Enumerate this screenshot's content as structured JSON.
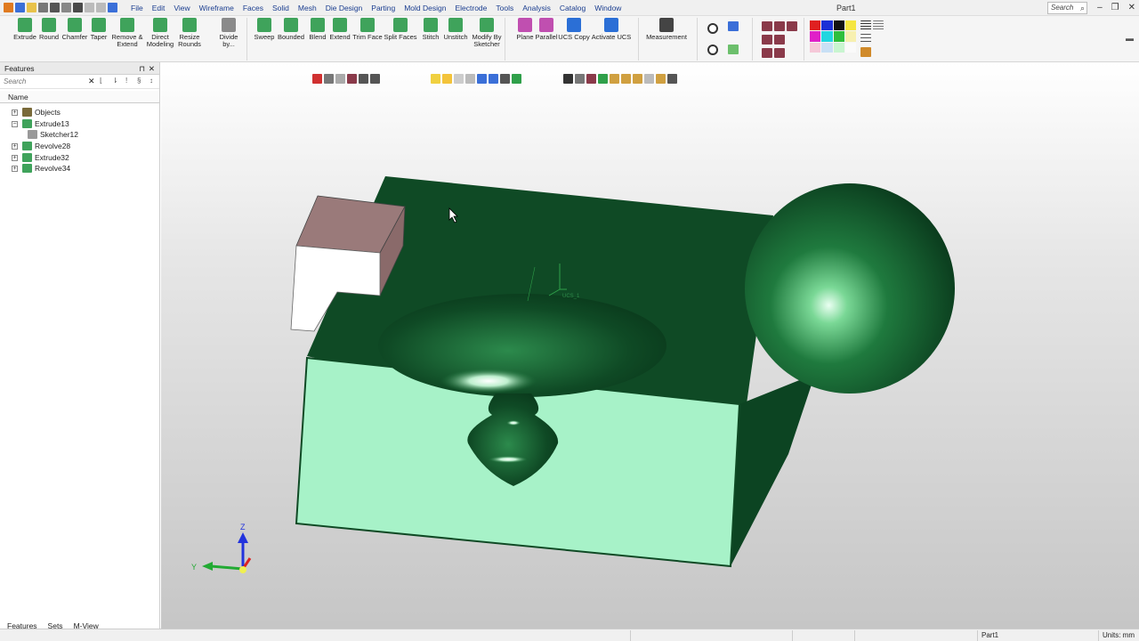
{
  "app": {
    "document_title": "Part1",
    "search_placeholder": "Search"
  },
  "menu": [
    "File",
    "Edit",
    "View",
    "Wireframe",
    "Faces",
    "Solid",
    "Mesh",
    "Die Design",
    "Parting",
    "Mold Design",
    "Electrode",
    "Tools",
    "Analysis",
    "Catalog",
    "Window"
  ],
  "ribbon": {
    "buttons": [
      {
        "label": "Extrude",
        "icon": "extrude-icon",
        "color": "#3fa35b"
      },
      {
        "label": "Round",
        "icon": "round-icon",
        "color": "#3fa35b"
      },
      {
        "label": "Chamfer",
        "icon": "chamfer-icon",
        "color": "#3fa35b"
      },
      {
        "label": "Taper",
        "icon": "taper-icon",
        "color": "#3fa35b"
      },
      {
        "label": "Remove &\nExtend",
        "icon": "remove-extend-icon",
        "color": "#3fa35b"
      },
      {
        "label": "Direct\nModeling",
        "icon": "direct-modeling-icon",
        "color": "#3fa35b"
      },
      {
        "label": "Resize\nRounds",
        "icon": "resize-rounds-icon",
        "color": "#3fa35b"
      },
      {
        "label": "Divide\nby...",
        "icon": "divide-icon",
        "color": "#8a8a8a"
      },
      {
        "label": "Sweep",
        "icon": "sweep-icon",
        "color": "#3fa35b"
      },
      {
        "label": "Bounded",
        "icon": "bounded-icon",
        "color": "#3fa35b"
      },
      {
        "label": "Blend",
        "icon": "blend-icon",
        "color": "#3fa35b"
      },
      {
        "label": "Extend",
        "icon": "extend-icon",
        "color": "#3fa35b"
      },
      {
        "label": "Trim Face",
        "icon": "trim-face-icon",
        "color": "#3fa35b"
      },
      {
        "label": "Split Faces",
        "icon": "split-faces-icon",
        "color": "#3fa35b"
      },
      {
        "label": "Stitch",
        "icon": "stitch-icon",
        "color": "#3fa35b"
      },
      {
        "label": "Unstitch",
        "icon": "unstitch-icon",
        "color": "#3fa35b"
      },
      {
        "label": "Modify By\nSketcher",
        "icon": "modify-sketcher-icon",
        "color": "#3fa35b"
      },
      {
        "label": "Plane",
        "icon": "plane-icon",
        "color": "#c04fb0"
      },
      {
        "label": "Parallel",
        "icon": "parallel-icon",
        "color": "#c04fb0"
      },
      {
        "label": "UCS Copy",
        "icon": "ucs-copy-icon",
        "color": "#2b6fd6"
      },
      {
        "label": "Activate UCS",
        "icon": "activate-ucs-icon",
        "color": "#2b6fd6"
      },
      {
        "label": "Measurement",
        "icon": "measurement-icon",
        "color": "#444444"
      }
    ]
  },
  "panel": {
    "title": "Features",
    "search_placeholder": "Search",
    "column_header": "Name",
    "tree": [
      {
        "label": "Objects",
        "expander": "+"
      },
      {
        "label": "Extrude13",
        "expander": "−"
      },
      {
        "label": "Sketcher12",
        "expander": ""
      },
      {
        "label": "Revolve28",
        "expander": "+"
      },
      {
        "label": "Extrude32",
        "expander": "+"
      },
      {
        "label": "Revolve34",
        "expander": "+"
      }
    ],
    "tabs": [
      "Features",
      "Sets",
      "M-View"
    ]
  },
  "viewport": {
    "ucs_label": "UCS_1",
    "axes": {
      "z": "Z",
      "y": "Y"
    }
  },
  "status": {
    "part": "Part1",
    "units": "Units: mm"
  },
  "colors": {
    "solid_dark": "#0f4a25",
    "solid_light": "#a7f2c8",
    "cube_top": "#9a7a7a",
    "accent_blue": "#1a3d8f"
  }
}
